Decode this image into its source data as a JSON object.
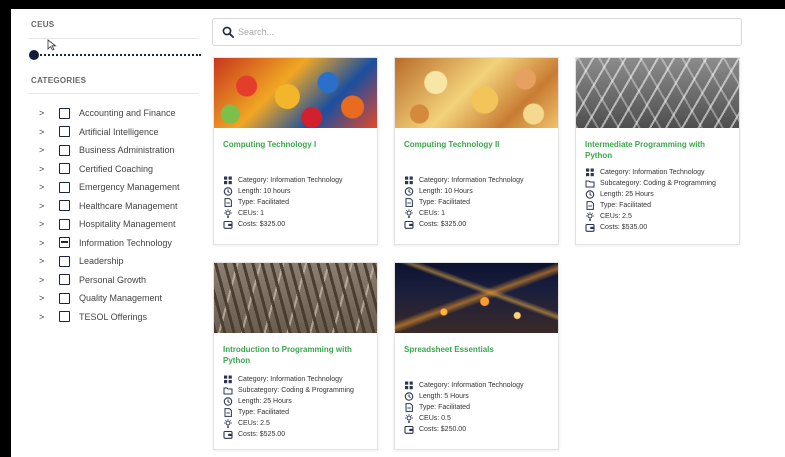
{
  "sidebar": {
    "ceus_title": "CEUS",
    "categories_title": "CATEGORIES",
    "ceus_slider_value": 0,
    "categories": [
      {
        "label": "Accounting and Finance",
        "checked": false
      },
      {
        "label": "Artificial Intelligence",
        "checked": false
      },
      {
        "label": "Business Administration",
        "checked": false
      },
      {
        "label": "Certified Coaching",
        "checked": false
      },
      {
        "label": "Emergency Management",
        "checked": false
      },
      {
        "label": "Healthcare Management",
        "checked": false
      },
      {
        "label": "Hospitality Management",
        "checked": false
      },
      {
        "label": "Information Technology",
        "checked": true
      },
      {
        "label": "Leadership",
        "checked": false
      },
      {
        "label": "Personal Growth",
        "checked": false
      },
      {
        "label": "Quality Management",
        "checked": false
      },
      {
        "label": "TESOL Offerings",
        "checked": false
      }
    ]
  },
  "search": {
    "placeholder": "Search..."
  },
  "courses": [
    {
      "title": "Computing Technology I",
      "category": "Category: Information Technology",
      "length": "Length: 10 hours",
      "type": "Type: Facilitated",
      "ceus": "CEUs: 1",
      "costs": "Costs: $325.00"
    },
    {
      "title": "Computing Technology II",
      "category": "Category: Information Technology",
      "length": "Length: 10 Hours",
      "type": "Type: Facilitated",
      "ceus": "CEUs: 1",
      "costs": "Costs: $325.00"
    },
    {
      "title": "Intermediate Programming with Python",
      "category": "Category: Information Technology",
      "subcategory": "Subcategory: Coding & Programming",
      "length": "Length: 25 Hours",
      "type": "Type: Facilitated",
      "ceus": "CEUs: 2.5",
      "costs": "Costs: $535.00"
    },
    {
      "title": "Introduction to Programming with Python",
      "category": "Category: Information Technology",
      "subcategory": "Subcategory: Coding & Programming",
      "length": "Length: 25 Hours",
      "type": "Type: Facilitated",
      "ceus": "CEUs: 2.5",
      "costs": "Costs: $525.00"
    },
    {
      "title": "Spreadsheet Essentials",
      "category": "Category: Information Technology",
      "length": "Length: 5 Hours",
      "type": "Type: Facilitated",
      "ceus": "CEUs: 0.5",
      "costs": "Costs: $250.00"
    }
  ],
  "icons": {
    "category": "grid-icon",
    "subcategory": "folder-icon",
    "length": "clock-icon",
    "type": "document-icon",
    "ceus": "lightbulb-icon",
    "costs": "wallet-icon",
    "search": "search-icon",
    "expand": "chevron-right-icon"
  },
  "colors": {
    "title_green": "#3aa74b",
    "checkbox_navy": "#1b2540",
    "frame": "#000000"
  }
}
